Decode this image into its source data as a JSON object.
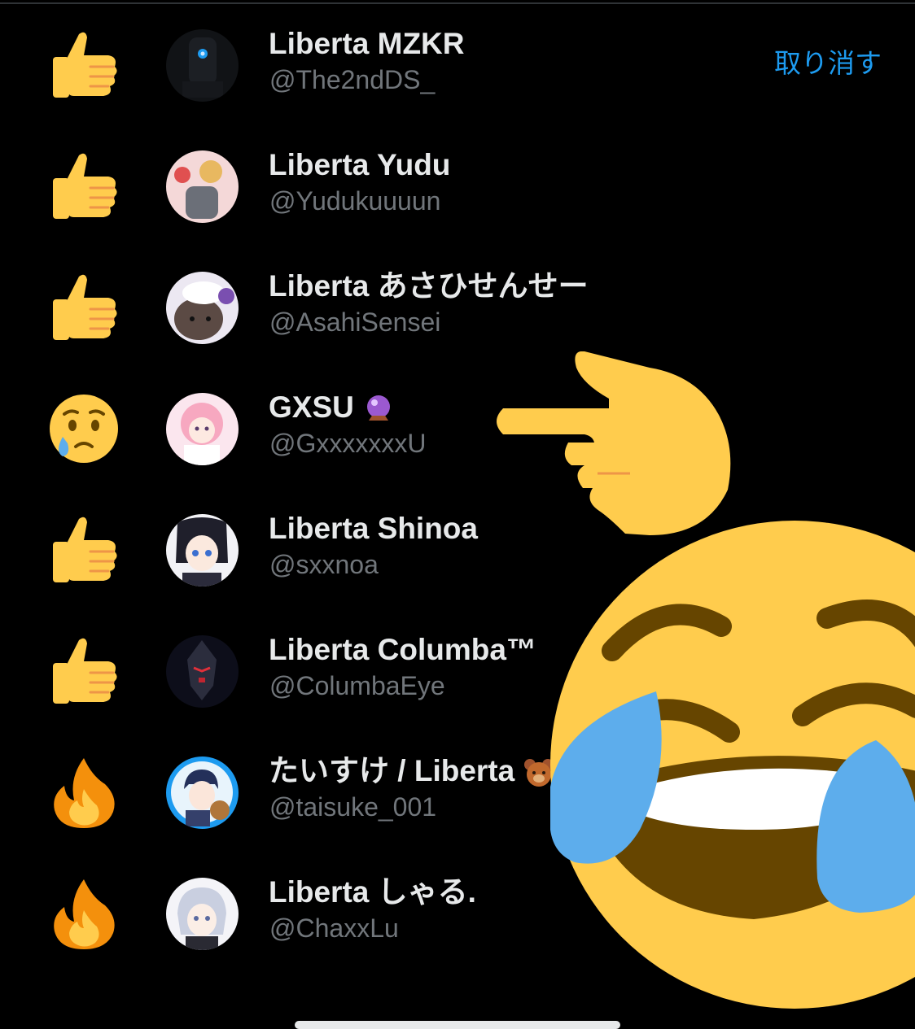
{
  "header": {
    "undo_label": "取り消す"
  },
  "users": [
    {
      "display_name": "Liberta MZKR",
      "handle": "@The2ndDS_",
      "reaction": "thumbs-up",
      "avatar_label": "MZKR"
    },
    {
      "display_name": "Liberta Yudu",
      "handle": "@Yudukuuuun",
      "reaction": "thumbs-up"
    },
    {
      "display_name": "Liberta あさひせんせー",
      "handle": "@AsahiSensei",
      "reaction": "thumbs-up"
    },
    {
      "display_name": "GXSU",
      "handle": "@GxxxxxxxU",
      "reaction": "crying-face",
      "name_emoji": "crystal-ball"
    },
    {
      "display_name": "Liberta Shinoa",
      "handle": "@sxxnoa",
      "reaction": "thumbs-up"
    },
    {
      "display_name": "Liberta Columba™",
      "handle": "@ColumbaEye",
      "reaction": "thumbs-up"
    },
    {
      "display_name": "たいすけ / Liberta",
      "handle": "@taisuke_001",
      "reaction": "fire",
      "name_emoji": "bear-face"
    },
    {
      "display_name": "Liberta しゃる.",
      "handle": "@ChaxxLu",
      "reaction": "fire"
    }
  ],
  "overlays": [
    {
      "icon": "backhand-index-pointing-right"
    },
    {
      "icon": "face-with-tears-of-joy"
    }
  ],
  "colors": {
    "background": "#000000",
    "name_text": "#e7e9ea",
    "handle_text": "#71767b",
    "accent": "#1d9bf0",
    "emoji_yellow": "#ffcc4d",
    "fire_orange": "#f4900c",
    "tear_blue": "#5dadec"
  }
}
